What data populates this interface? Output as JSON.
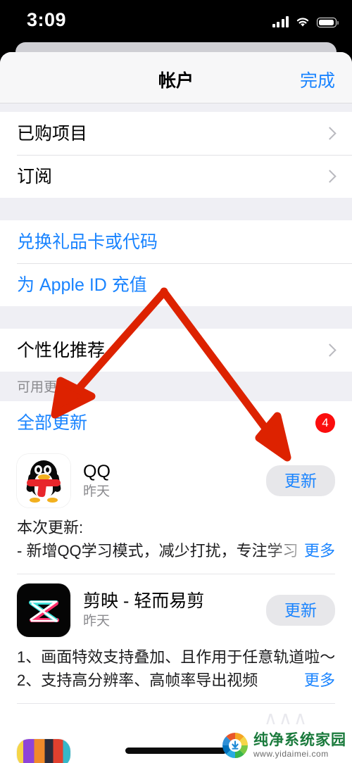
{
  "status_bar": {
    "time": "3:09",
    "signal_icon": "cellular-signal-icon",
    "wifi_icon": "wifi-icon",
    "battery_icon": "battery-full-icon"
  },
  "nav": {
    "title": "帐户",
    "done_label": "完成",
    "accent_color": "#1a84ff"
  },
  "sections": {
    "account": {
      "items": [
        {
          "label": "已购项目",
          "chevron": true,
          "style": "dark"
        },
        {
          "label": "订阅",
          "chevron": true,
          "style": "dark"
        }
      ]
    },
    "redeem": {
      "items": [
        {
          "label": "兑换礼品卡或代码",
          "chevron": false,
          "style": "blue"
        },
        {
          "label": "为 Apple ID 充值",
          "chevron": false,
          "style": "blue"
        }
      ]
    },
    "recommend": {
      "items": [
        {
          "label": "个性化推荐",
          "chevron": true,
          "style": "dark"
        }
      ]
    },
    "updates": {
      "header": "可用更新",
      "update_all_label": "全部更新",
      "badge_count": "4",
      "badge_color": "#fb0d0d"
    }
  },
  "apps": [
    {
      "name": "QQ",
      "subtitle": "昨天",
      "button_label": "更新",
      "icon": "qq-penguin-icon",
      "notes": [
        "本次更新:",
        "- 新增QQ学习模式，减少打扰，专注学习更"
      ],
      "more_label": "更多"
    },
    {
      "name": "剪映 - 轻而易剪",
      "subtitle": "昨天",
      "button_label": "更新",
      "icon": "capcut-icon",
      "notes": [
        "1、画面特效支持叠加、且作用于任意轨道啦～",
        "2、支持高分辨率、高帧率导出视频"
      ],
      "more_label": "更多"
    }
  ],
  "annotations": {
    "color": "#dd2200",
    "arrow_left_target": "全部更新",
    "arrow_right_target": "更新"
  },
  "watermark": {
    "title": "纯净系统家园",
    "url": "www.yidaimei.com",
    "logo": "download-diamond-logo"
  }
}
